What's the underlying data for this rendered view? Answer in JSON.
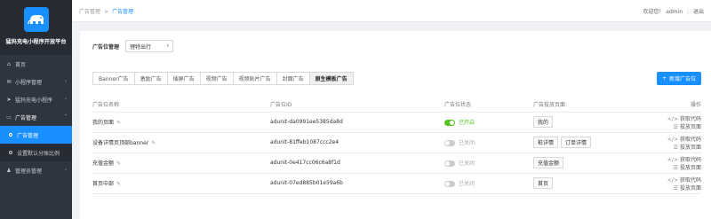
{
  "app": {
    "brand": "猛犸充电小程序开放平台"
  },
  "sidebar": {
    "items": [
      {
        "label": "首页",
        "icon": "home-icon",
        "glyph": "⌂"
      },
      {
        "label": "小程序管理",
        "icon": "chat-icon",
        "glyph": "✉",
        "arrow": "‹"
      },
      {
        "label": "猛犸充电小程序",
        "icon": "bolt-icon",
        "glyph": "➤",
        "arrow": "‹"
      },
      {
        "label": "广告管理",
        "icon": "monitor-icon",
        "glyph": "▭",
        "arrow": "˄"
      }
    ],
    "sub_items": [
      {
        "label": "广告管理",
        "active": true
      },
      {
        "label": "设置默认分账比例",
        "active": false
      }
    ],
    "bottom_item": {
      "label": "管理员管理",
      "icon": "admin-icon",
      "glyph": "♟",
      "arrow": "‹"
    }
  },
  "header": {
    "breadcrumb": [
      "广告管理",
      "广告管理"
    ],
    "separator": ">",
    "welcome": "欢迎您！",
    "user": "admin",
    "divider": "|",
    "logout": "退出"
  },
  "filter": {
    "label": "广告位管理",
    "select_value": "锂特出行"
  },
  "tabs": [
    "Banner广告",
    "激励广告",
    "插屏广告",
    "视频广告",
    "视频贴片广告",
    "封面广告",
    "原生模板广告"
  ],
  "active_tab": 6,
  "add_button": "新增广告位",
  "table": {
    "headers": [
      "广告位名称",
      "广告位ID",
      "广告位状态",
      "广告投放页面",
      "操作"
    ],
    "rows": [
      {
        "name": "我的页面",
        "id": "adunit-da0991ee5385da8d",
        "on": true,
        "status": "已开启",
        "pages": [
          "我的"
        ],
        "op1": "获取代码",
        "op2": "投放页面"
      },
      {
        "name": "设备详情页顶部banner",
        "id": "adunit-81ffeb1087ccc2e4",
        "on": false,
        "status": "已关闭",
        "pages": [
          "桩详情",
          "订单详情"
        ],
        "op1": "获取代码",
        "op2": "投放页面"
      },
      {
        "name": "充值金额",
        "id": "adunit-0e417cc06c6a8f1d",
        "on": false,
        "status": "已关闭",
        "pages": [
          "充值金额"
        ],
        "op1": "获取代码",
        "op2": "投放页面"
      },
      {
        "name": "首页中部",
        "id": "adunit-07ed885b01e59a6b",
        "on": false,
        "status": "已关闭",
        "pages": [
          "首页"
        ],
        "op1": "获取代码",
        "op2": "投放页面"
      }
    ]
  },
  "colors": {
    "accent": "#1890ff",
    "sidebar": "#2f3540",
    "success": "#52c41a"
  }
}
